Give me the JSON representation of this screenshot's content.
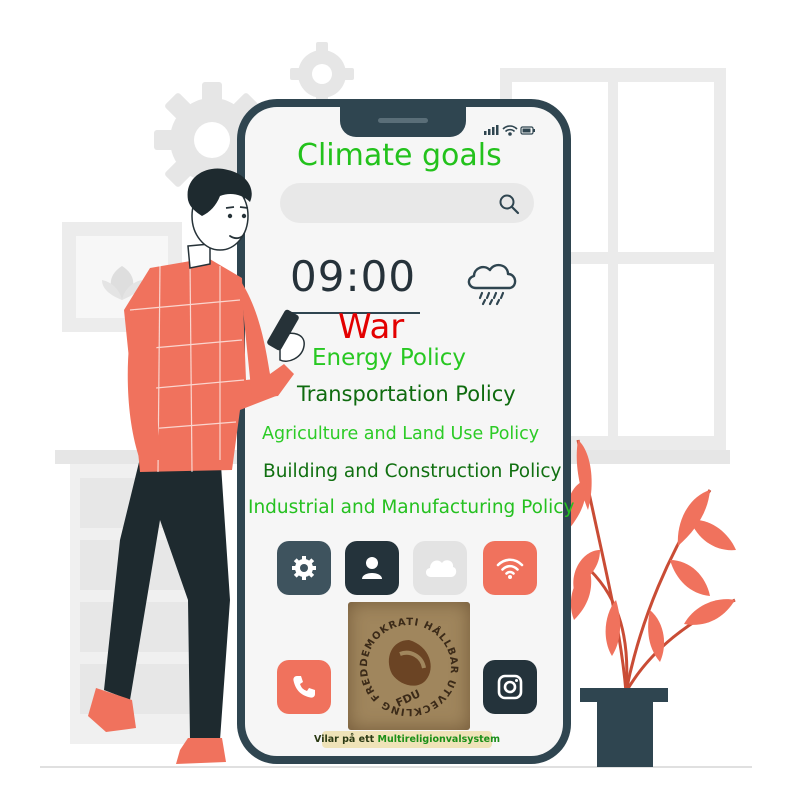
{
  "screen": {
    "title": "Climate goals",
    "clock": "09:00",
    "headline": "War",
    "policies": [
      "Energy Policy",
      "Transportation Policy",
      "Agriculture and Land Use Policy",
      "Building and Construction Policy",
      "Industrial and Manufacturing Policy"
    ]
  },
  "stamp": {
    "letters": "DEMOKRATI HÅLLBAR UTVECKLING FRED FDU",
    "caption_prefix": "Vilar på ett",
    "caption_highlight": "Multireligionvalsystem"
  },
  "icons": {
    "search": "search-icon",
    "weather": "rain-cloud-icon",
    "apps_row1": [
      "gear-icon",
      "contact-icon",
      "cloud-icon",
      "wifi-icon"
    ],
    "apps_row2": [
      "phone-icon",
      "instagram-icon"
    ]
  },
  "colors": {
    "phone_body": "#2f4550",
    "accent_red": "#f0725d",
    "title_green": "#23c21c",
    "war_red": "#e30000",
    "dark_green": "#0f6b0f"
  }
}
